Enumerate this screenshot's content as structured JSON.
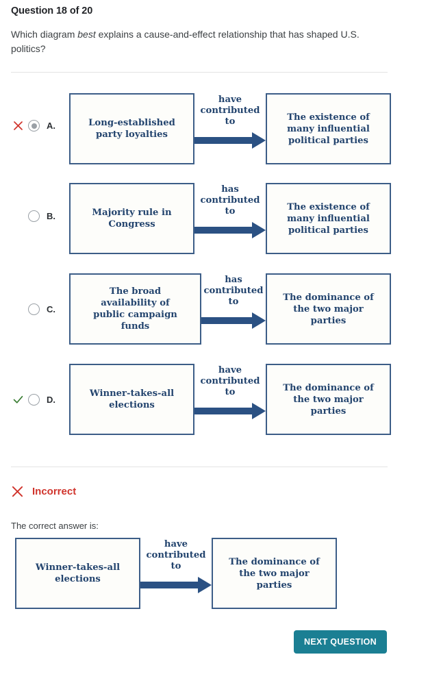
{
  "header": {
    "question_counter": "Question 18 of 20",
    "prompt_part1": "Which diagram ",
    "prompt_emphasis": "best",
    "prompt_part2": " explains a cause-and-effect relationship that has shaped U.S. politics?"
  },
  "colors": {
    "box_border": "#3c5d87",
    "box_fill": "#fdfdfa",
    "diagram_text": "#23446e",
    "arrow": "#2b5183",
    "incorrect_red": "#d0342c",
    "correct_green": "#3a7d33",
    "radio_gray": "#9aa0a6",
    "button_teal": "#1b7f93",
    "divider": "#e3e3e3"
  },
  "options": [
    {
      "letter": "A.",
      "status_icon": "x-icon",
      "selected": true,
      "cause": "Long-established\nparty loyalties",
      "connector": "have\ncontributed\nto",
      "effect": "The existence of\nmany influential\npolitical parties"
    },
    {
      "letter": "B.",
      "status_icon": "none",
      "selected": false,
      "cause": "Majority rule in\nCongress",
      "connector": "has\ncontributed\nto",
      "effect": "The existence of\nmany influential\npolitical parties"
    },
    {
      "letter": "C.",
      "status_icon": "none",
      "selected": false,
      "cause": "The broad\navailability of\npublic campaign\nfunds",
      "connector": "has\ncontributed\nto",
      "effect": "The dominance of\nthe two major\nparties"
    },
    {
      "letter": "D.",
      "status_icon": "check-icon",
      "selected": false,
      "cause": "Winner-takes-all\nelections",
      "connector": "have\ncontributed\nto",
      "effect": "The dominance of\nthe two major\nparties"
    }
  ],
  "feedback": {
    "status_label": "Incorrect",
    "status_icon": "x-icon",
    "correct_answer_intro": "The correct answer is:",
    "correct_diagram": {
      "cause": "Winner-takes-all\nelections",
      "connector": "have\ncontributed\nto",
      "effect": "The dominance of\nthe two major\nparties"
    }
  },
  "footer": {
    "next_button_label": "NEXT QUESTION"
  }
}
